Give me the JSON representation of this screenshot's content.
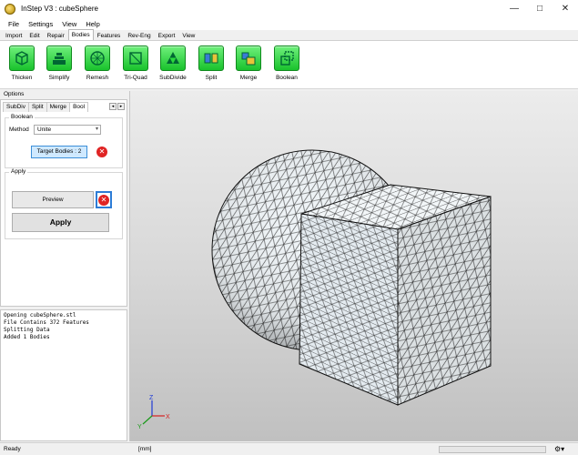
{
  "window": {
    "title": "InStep V3 : cubeSphere"
  },
  "menu": [
    "File",
    "Settings",
    "View",
    "Help"
  ],
  "tabs": [
    "Import",
    "Edit",
    "Repair",
    "Bodies",
    "Features",
    "Rev-Eng",
    "Export",
    "View"
  ],
  "active_tab": "Bodies",
  "toolbar": [
    "Thicken",
    "Simplify",
    "Remesh",
    "Tri-Quad",
    "SubDivide",
    "Split",
    "Merge",
    "Boolean"
  ],
  "options": {
    "label": "Options",
    "subtabs": [
      "SubDiv",
      "Split",
      "Merge",
      "Bool"
    ],
    "active_subtab": "Bool",
    "arrows": [
      "◂",
      "▸"
    ],
    "boolean_group": "Boolean",
    "method_label": "Method",
    "method_value": "Unite",
    "target_bodies": "Target Bodies : 2",
    "apply_group": "Apply",
    "preview_label": "Preview",
    "apply_label": "Apply"
  },
  "console": [
    "Opening cubeSphere.stl",
    "File Contains 372 Features",
    "Splitting Data",
    "Added 1 Bodies"
  ],
  "axes": {
    "x": "X",
    "y": "Y",
    "z": "Z"
  },
  "status": {
    "ready": "Ready",
    "units": "[mm]"
  },
  "colors": {
    "tool_green": "#2ad83c",
    "mesh_fill": "#e8eef2",
    "delete_red": "#e02424",
    "accent_blue": "#2d7cd6"
  }
}
